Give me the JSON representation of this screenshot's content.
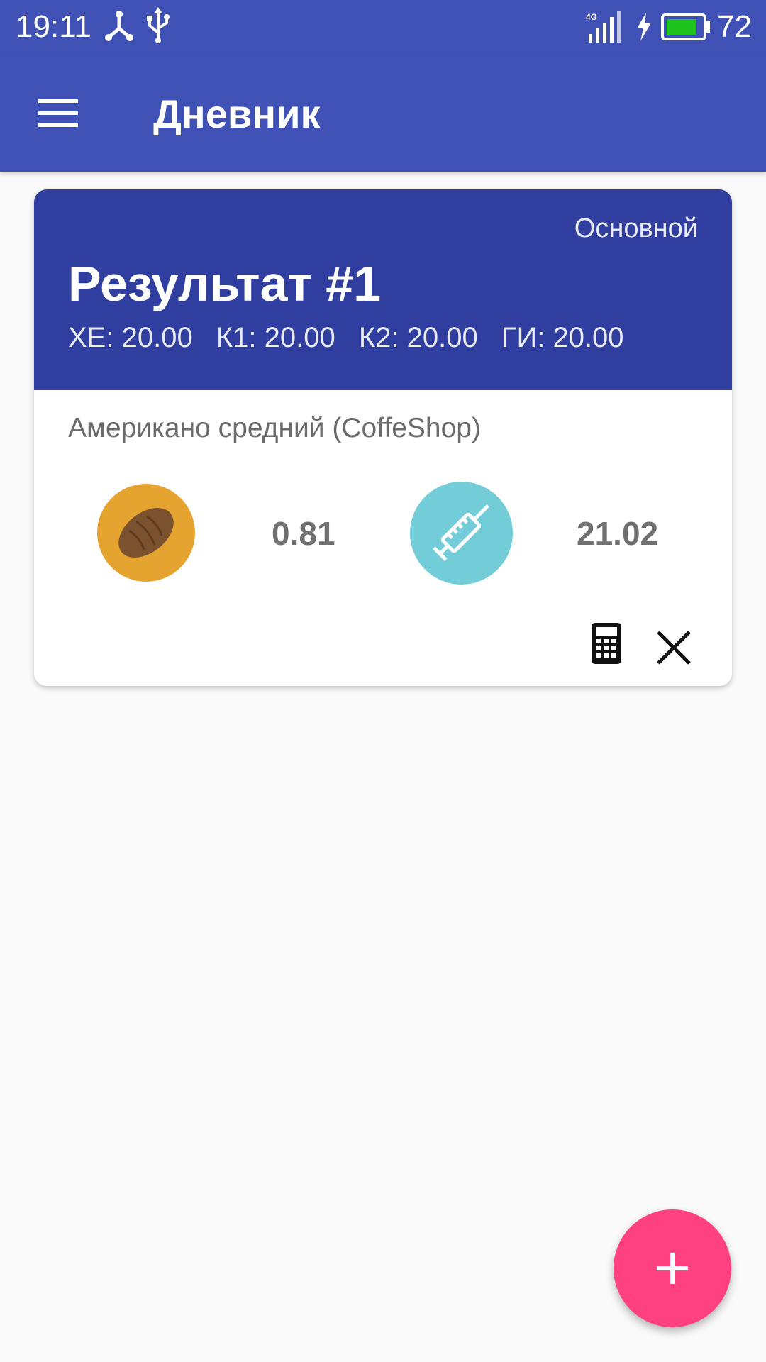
{
  "status_bar": {
    "time": "19:11",
    "battery_percent": "72",
    "network": "4G",
    "icons": [
      "sync-hub-icon",
      "usb-icon",
      "signal-icon",
      "charging-icon",
      "battery-icon"
    ]
  },
  "app_bar": {
    "title": "Дневник",
    "menu_icon": "menu-icon"
  },
  "card": {
    "profile": "Основной",
    "title": "Результат #1",
    "metrics": {
      "xe": "ХЕ: 20.00",
      "k1": "К1: 20.00",
      "k2": "К2: 20.00",
      "gi": "ГИ: 20.00"
    },
    "food_name": "Американо средний (CoffeShop)",
    "bread_units_value": "0.81",
    "insulin_value": "21.02",
    "icons": [
      "bread-icon",
      "syringe-icon",
      "calculator-icon",
      "close-icon"
    ]
  },
  "fab": {
    "icon": "plus-icon"
  },
  "colors": {
    "primary": "#3f51b5",
    "primary_dark": "#303f9f",
    "accent": "#ff4081",
    "bread_circle": "#e5a330",
    "syringe_circle": "#72cdd9"
  }
}
